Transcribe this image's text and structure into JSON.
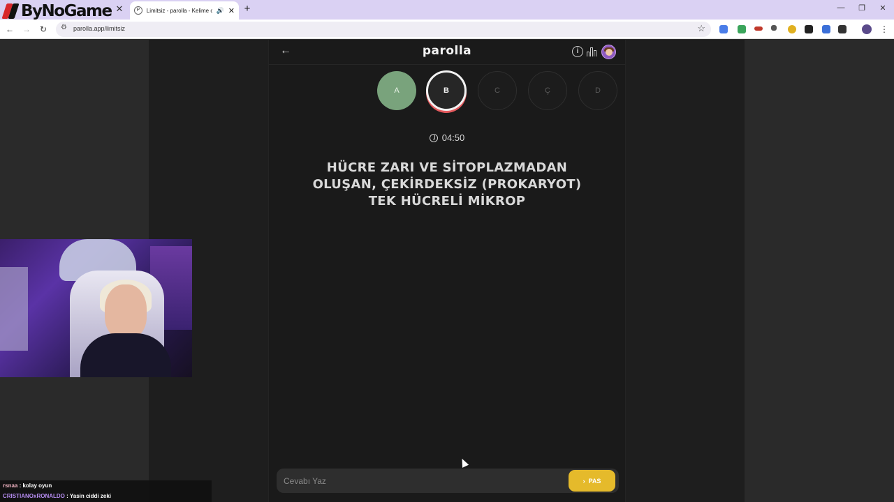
{
  "browser": {
    "tabs": [
      {
        "label": "ByNoGame"
      },
      {
        "label": "Limitsiz - parolla - Kelime o"
      }
    ],
    "url": "parolla.app/limitsiz",
    "new_tab_label": "+",
    "close_label": "✕"
  },
  "app": {
    "brand": "parolla",
    "back_label": "←",
    "info_label": "i",
    "letters": [
      {
        "letter": "A",
        "state": "done"
      },
      {
        "letter": "B",
        "state": "active"
      },
      {
        "letter": "C",
        "state": "idle"
      },
      {
        "letter": "Ç",
        "state": "idle"
      },
      {
        "letter": "D",
        "state": "idle"
      }
    ],
    "timer": "04:50",
    "question": "HÜCRE ZARI VE SİTOPLAZMADAN OLUŞAN, ÇEKİRDEKSİZ (PROKARYOT) TEK HÜCRELİ MİKROP",
    "answer_placeholder": "Cevabı Yaz",
    "pass_label": "PAS",
    "pass_icon": "›"
  },
  "chat": [
    {
      "user": "rsnaa",
      "message": " : kolay oyun"
    },
    {
      "user": "CRISTIANOxRONALDO",
      "message": " : Yasin ciddi zeki"
    }
  ],
  "colors": {
    "done": "#79a37c",
    "active_ring": "#e3595d",
    "pass_button": "#e5ba2b",
    "tab_strip": "#dad1f3"
  }
}
